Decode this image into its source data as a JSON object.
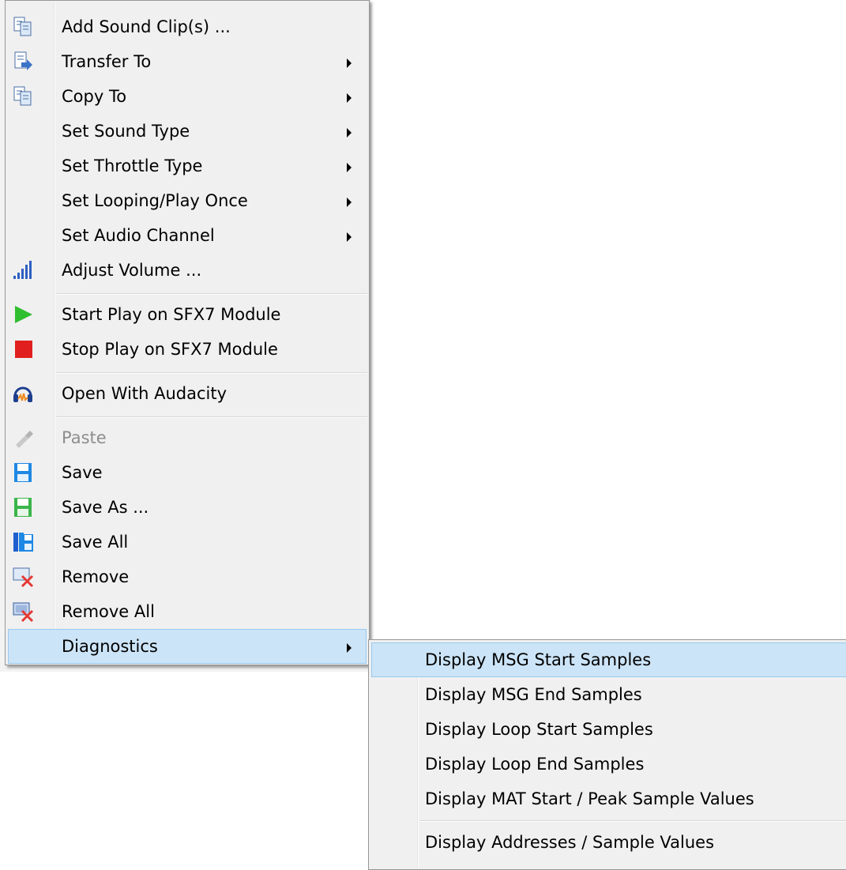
{
  "main_menu": {
    "items": [
      {
        "label": "Add Sound Clip(s) ...",
        "icon": "copy-icon",
        "submenu": false
      },
      {
        "label": "Transfer To",
        "icon": "transfer-icon",
        "submenu": true
      },
      {
        "label": "Copy To",
        "icon": "copy-icon",
        "submenu": true
      },
      {
        "label": "Set Sound Type",
        "icon": "",
        "submenu": true
      },
      {
        "label": "Set Throttle Type",
        "icon": "",
        "submenu": true
      },
      {
        "label": "Set Looping/Play Once",
        "icon": "",
        "submenu": true
      },
      {
        "label": "Set Audio Channel",
        "icon": "",
        "submenu": true
      },
      {
        "label": "Adjust Volume ...",
        "icon": "volume-bars-icon",
        "submenu": false
      },
      {
        "label": "Start Play on SFX7 Module",
        "icon": "play-icon",
        "submenu": false
      },
      {
        "label": "Stop Play on SFX7 Module",
        "icon": "stop-icon",
        "submenu": false
      },
      {
        "label": "Open With Audacity",
        "icon": "audacity-icon",
        "submenu": false
      },
      {
        "label": "Paste",
        "icon": "paste-icon",
        "submenu": false,
        "disabled": true
      },
      {
        "label": "Save",
        "icon": "save-icon",
        "submenu": false
      },
      {
        "label": "Save As ...",
        "icon": "save-as-icon",
        "submenu": false
      },
      {
        "label": "Save All",
        "icon": "save-all-icon",
        "submenu": false
      },
      {
        "label": "Remove",
        "icon": "remove-icon",
        "submenu": false
      },
      {
        "label": "Remove All",
        "icon": "remove-all-icon",
        "submenu": false
      },
      {
        "label": "Diagnostics",
        "icon": "",
        "submenu": true,
        "highlighted": true
      }
    ]
  },
  "diagnostics_submenu": {
    "items": [
      {
        "label": "Display MSG Start Samples",
        "highlighted": true
      },
      {
        "label": "Display MSG End Samples"
      },
      {
        "label": "Display Loop Start Samples"
      },
      {
        "label": "Display Loop End Samples"
      },
      {
        "label": "Display MAT Start / Peak Sample Values"
      },
      {
        "label": "Display Addresses / Sample Values"
      }
    ]
  },
  "colors": {
    "menu_bg": "#f0f0f0",
    "highlight": "#cce4f7",
    "highlight_border": "#99c9ef",
    "disabled_text": "#8d8d8d"
  }
}
